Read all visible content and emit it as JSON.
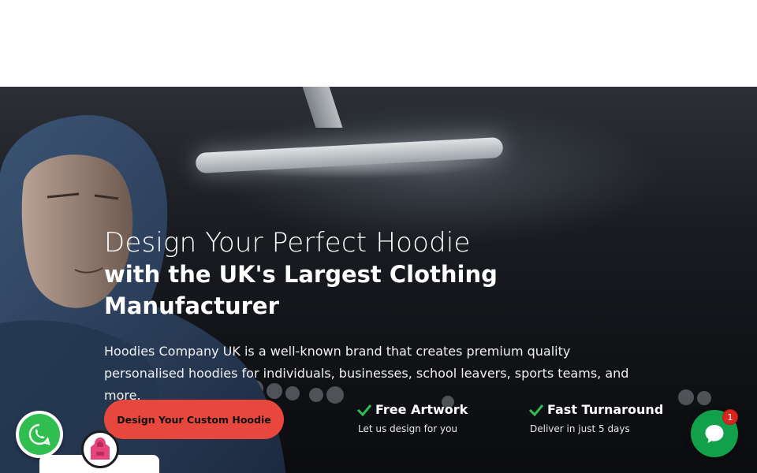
{
  "hero": {
    "headline_light": "Design Your Perfect Hoodie",
    "headline_bold": "with the UK's Largest Clothing Manufacturer",
    "intro": "Hoodies Company UK is a well-known brand that creates premium quality personalised hoodies for individuals, businesses, school leavers, sports teams, and more.",
    "cta_label": "Design Your Custom Hoodie"
  },
  "features": [
    {
      "title": "Free Artwork",
      "subtitle": "Let us design for you",
      "icon": "check-icon"
    },
    {
      "title": "Fast Turnaround",
      "subtitle": "Deliver in just 5 days",
      "icon": "check-icon"
    }
  ],
  "widgets": {
    "whatsapp_icon": "whatsapp-icon",
    "hoodie_icon": "hoodie-icon",
    "chat_icon": "chat-icon",
    "chat_unread_count": "1"
  },
  "colors": {
    "cta_background": "#e8473e",
    "check_green": "#2fbe4f",
    "whatsapp_green": "#2fbe4f",
    "chat_green": "#13a04b",
    "badge_red": "#d7261e"
  }
}
